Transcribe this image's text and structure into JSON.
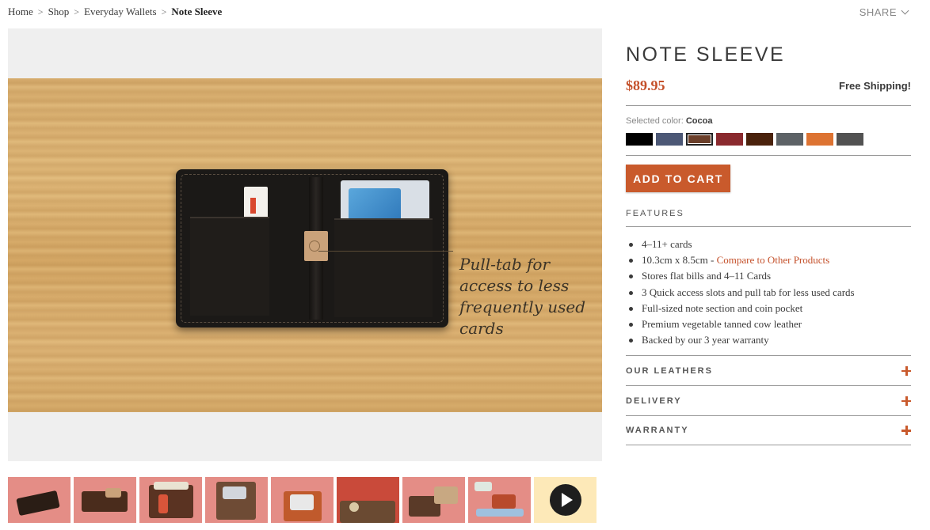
{
  "breadcrumb": {
    "items": [
      "Home",
      "Shop",
      "Everyday Wallets"
    ],
    "current": "Note Sleeve",
    "separator": ">"
  },
  "share": {
    "label": "SHARE"
  },
  "main_image": {
    "callout": "Pull-tab for access to less frequently used cards"
  },
  "thumbnails": {
    "count": 9,
    "last_is_video": true
  },
  "product": {
    "title": "NOTE SLEEVE",
    "price": "$89.95",
    "shipping": "Free Shipping!",
    "color_label": "Selected color:",
    "color_value": "Cocoa",
    "swatches": [
      {
        "name": "black",
        "color": "#000000"
      },
      {
        "name": "slate-blue",
        "color": "#4c5876"
      },
      {
        "name": "cocoa",
        "color": "#6b3f2a",
        "selected": true
      },
      {
        "name": "red",
        "color": "#8a2a2e"
      },
      {
        "name": "dark-brown",
        "color": "#4a220c"
      },
      {
        "name": "charcoal",
        "color": "#5d6266"
      },
      {
        "name": "orange",
        "color": "#dd7332"
      },
      {
        "name": "grey",
        "color": "#525252"
      }
    ],
    "add_to_cart": "ADD TO CART"
  },
  "features": {
    "heading": "FEATURES",
    "items": [
      "4–11+ cards",
      "10.3cm x 8.5cm - ",
      "Stores flat bills and 4–11 Cards",
      "3 Quick access slots and pull tab for less used cards",
      "Full-sized note section and coin pocket",
      "Premium vegetable tanned cow leather",
      "Backed by our 3 year warranty"
    ],
    "compare_link": "Compare to Other Products"
  },
  "accordions": [
    {
      "label": "OUR LEATHERS"
    },
    {
      "label": "DELIVERY"
    },
    {
      "label": "WARRANTY"
    }
  ],
  "colors": {
    "accent": "#c95a2c",
    "price": "#c4502a"
  }
}
